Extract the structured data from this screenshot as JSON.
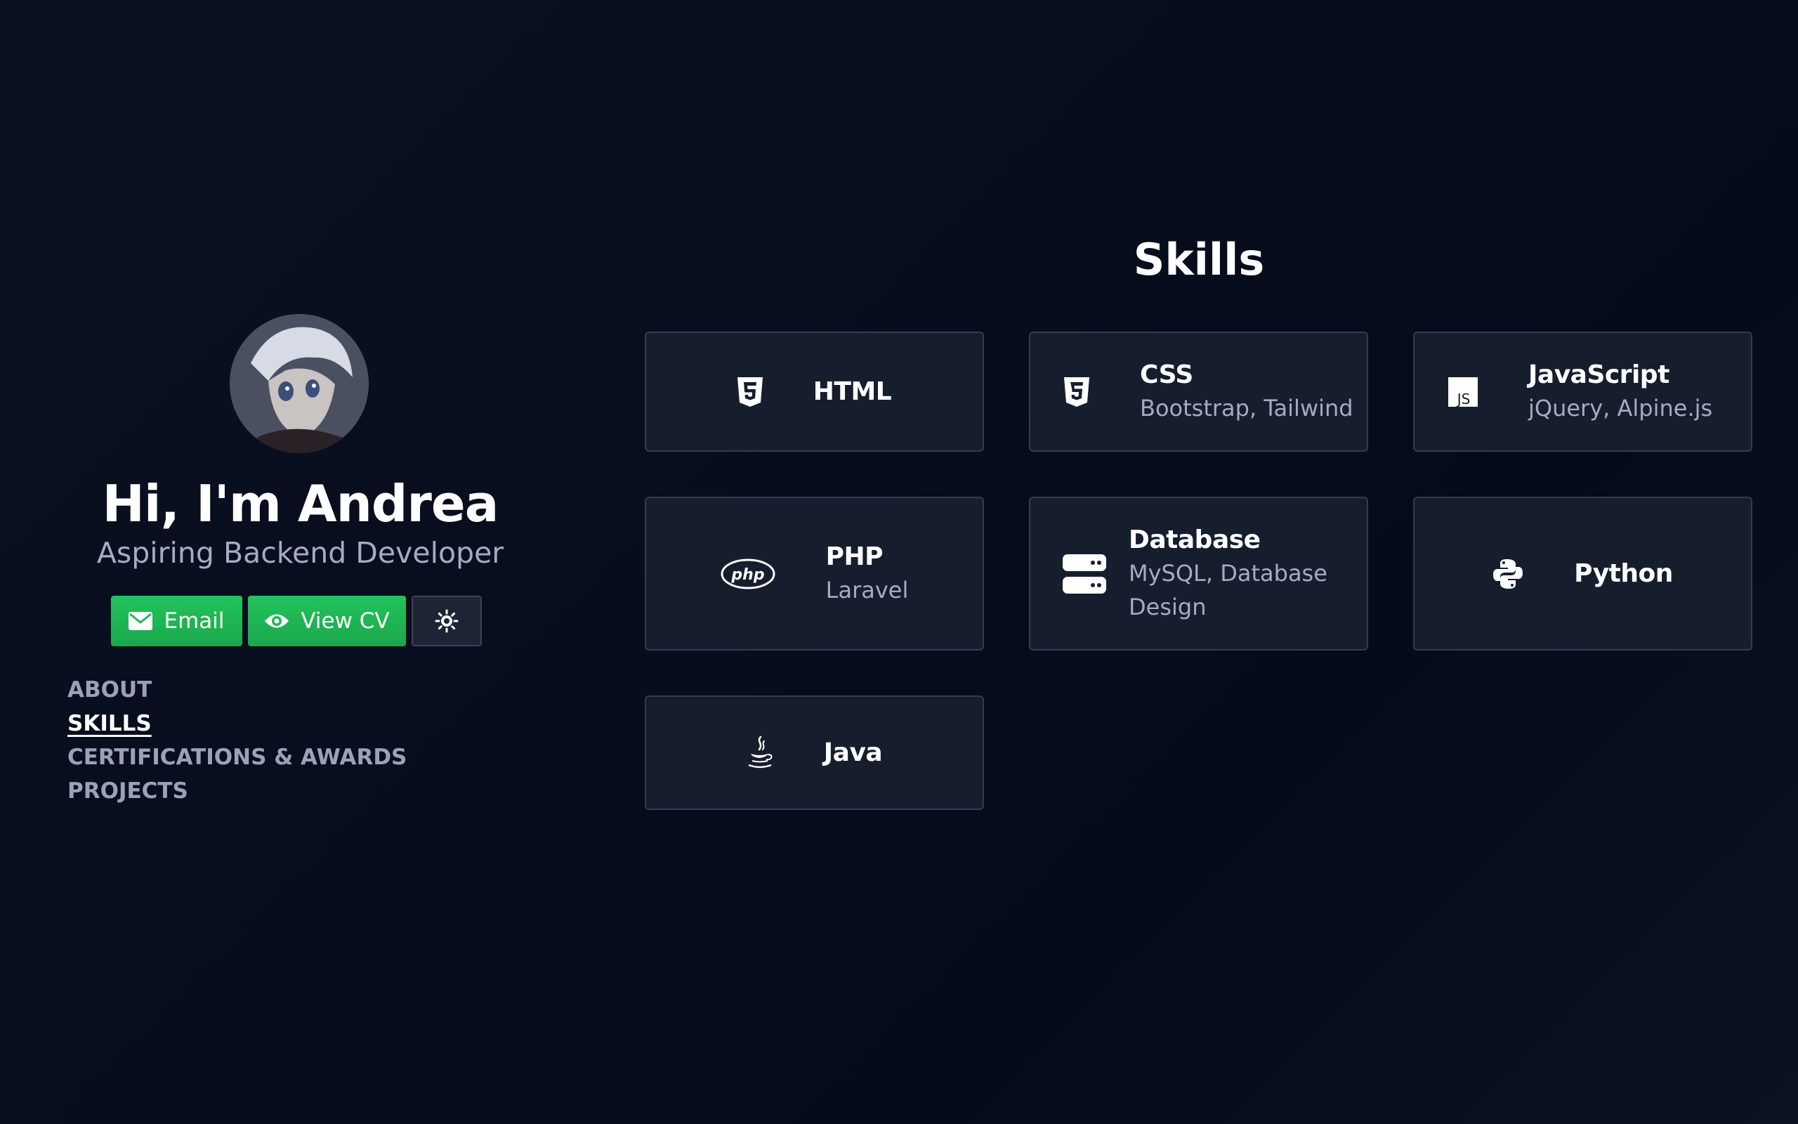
{
  "profile": {
    "greeting": "Hi, I'm Andrea",
    "role": "Aspiring Backend Developer",
    "avatar_icon": "avatar-photo"
  },
  "actions": {
    "email_label": "Email",
    "email_icon": "envelope-icon",
    "cv_label": "View CV",
    "cv_icon": "eye-icon",
    "theme_icon": "sun-icon"
  },
  "nav": {
    "items": [
      {
        "label": "ABOUT",
        "active": false
      },
      {
        "label": "SKILLS",
        "active": true
      },
      {
        "label": "CERTIFICATIONS & AWARDS",
        "active": false
      },
      {
        "label": "PROJECTS",
        "active": false
      }
    ]
  },
  "skills": {
    "title": "Skills",
    "cards": [
      {
        "name": "HTML",
        "details": "",
        "icon": "html5-icon"
      },
      {
        "name": "CSS",
        "details": "Bootstrap, Tailwind",
        "icon": "css3-icon"
      },
      {
        "name": "JavaScript",
        "details": "jQuery, Alpine.js",
        "icon": "js-icon"
      },
      {
        "name": "PHP",
        "details": "Laravel",
        "icon": "php-icon"
      },
      {
        "name": "Database",
        "details": "MySQL, Database Design",
        "icon": "database-icon"
      },
      {
        "name": "Python",
        "details": "",
        "icon": "python-icon"
      },
      {
        "name": "Java",
        "details": "",
        "icon": "java-icon"
      }
    ]
  },
  "colors": {
    "background": "#070d1d",
    "card": "#161e2e",
    "accent_green": "#1fb855",
    "muted_text": "#a3adbf"
  }
}
